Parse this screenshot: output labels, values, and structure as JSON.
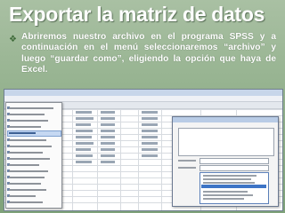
{
  "slide": {
    "title": "Exportar la matriz de datos",
    "bullet": "Abriremos nuestro archivo en el programa SPSS y a continuación en el menú seleccionaremos “archivo” y luego “guardar como”, eligiendo la opción que haya de Excel."
  },
  "colors": {
    "background": "#93b08d",
    "title_text": "#ffffff",
    "body_text": "#ffffff",
    "bullet_mark": "#3f6b3a"
  },
  "screenshot": {
    "app": "SPSS",
    "open_menu": "archivo",
    "selected_menu_item": "guardar como",
    "dialog_selected_option": "Excel"
  }
}
